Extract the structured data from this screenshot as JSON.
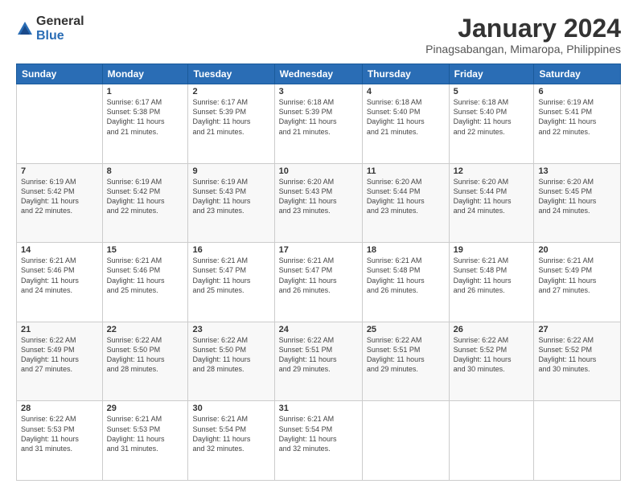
{
  "logo": {
    "general": "General",
    "blue": "Blue"
  },
  "title": "January 2024",
  "location": "Pinagsabangan, Mimaropa, Philippines",
  "days_header": [
    "Sunday",
    "Monday",
    "Tuesday",
    "Wednesday",
    "Thursday",
    "Friday",
    "Saturday"
  ],
  "weeks": [
    [
      {
        "day": "",
        "info": ""
      },
      {
        "day": "1",
        "info": "Sunrise: 6:17 AM\nSunset: 5:38 PM\nDaylight: 11 hours\nand 21 minutes."
      },
      {
        "day": "2",
        "info": "Sunrise: 6:17 AM\nSunset: 5:39 PM\nDaylight: 11 hours\nand 21 minutes."
      },
      {
        "day": "3",
        "info": "Sunrise: 6:18 AM\nSunset: 5:39 PM\nDaylight: 11 hours\nand 21 minutes."
      },
      {
        "day": "4",
        "info": "Sunrise: 6:18 AM\nSunset: 5:40 PM\nDaylight: 11 hours\nand 21 minutes."
      },
      {
        "day": "5",
        "info": "Sunrise: 6:18 AM\nSunset: 5:40 PM\nDaylight: 11 hours\nand 22 minutes."
      },
      {
        "day": "6",
        "info": "Sunrise: 6:19 AM\nSunset: 5:41 PM\nDaylight: 11 hours\nand 22 minutes."
      }
    ],
    [
      {
        "day": "7",
        "info": "Sunrise: 6:19 AM\nSunset: 5:42 PM\nDaylight: 11 hours\nand 22 minutes."
      },
      {
        "day": "8",
        "info": "Sunrise: 6:19 AM\nSunset: 5:42 PM\nDaylight: 11 hours\nand 22 minutes."
      },
      {
        "day": "9",
        "info": "Sunrise: 6:19 AM\nSunset: 5:43 PM\nDaylight: 11 hours\nand 23 minutes."
      },
      {
        "day": "10",
        "info": "Sunrise: 6:20 AM\nSunset: 5:43 PM\nDaylight: 11 hours\nand 23 minutes."
      },
      {
        "day": "11",
        "info": "Sunrise: 6:20 AM\nSunset: 5:44 PM\nDaylight: 11 hours\nand 23 minutes."
      },
      {
        "day": "12",
        "info": "Sunrise: 6:20 AM\nSunset: 5:44 PM\nDaylight: 11 hours\nand 24 minutes."
      },
      {
        "day": "13",
        "info": "Sunrise: 6:20 AM\nSunset: 5:45 PM\nDaylight: 11 hours\nand 24 minutes."
      }
    ],
    [
      {
        "day": "14",
        "info": "Sunrise: 6:21 AM\nSunset: 5:46 PM\nDaylight: 11 hours\nand 24 minutes."
      },
      {
        "day": "15",
        "info": "Sunrise: 6:21 AM\nSunset: 5:46 PM\nDaylight: 11 hours\nand 25 minutes."
      },
      {
        "day": "16",
        "info": "Sunrise: 6:21 AM\nSunset: 5:47 PM\nDaylight: 11 hours\nand 25 minutes."
      },
      {
        "day": "17",
        "info": "Sunrise: 6:21 AM\nSunset: 5:47 PM\nDaylight: 11 hours\nand 26 minutes."
      },
      {
        "day": "18",
        "info": "Sunrise: 6:21 AM\nSunset: 5:48 PM\nDaylight: 11 hours\nand 26 minutes."
      },
      {
        "day": "19",
        "info": "Sunrise: 6:21 AM\nSunset: 5:48 PM\nDaylight: 11 hours\nand 26 minutes."
      },
      {
        "day": "20",
        "info": "Sunrise: 6:21 AM\nSunset: 5:49 PM\nDaylight: 11 hours\nand 27 minutes."
      }
    ],
    [
      {
        "day": "21",
        "info": "Sunrise: 6:22 AM\nSunset: 5:49 PM\nDaylight: 11 hours\nand 27 minutes."
      },
      {
        "day": "22",
        "info": "Sunrise: 6:22 AM\nSunset: 5:50 PM\nDaylight: 11 hours\nand 28 minutes."
      },
      {
        "day": "23",
        "info": "Sunrise: 6:22 AM\nSunset: 5:50 PM\nDaylight: 11 hours\nand 28 minutes."
      },
      {
        "day": "24",
        "info": "Sunrise: 6:22 AM\nSunset: 5:51 PM\nDaylight: 11 hours\nand 29 minutes."
      },
      {
        "day": "25",
        "info": "Sunrise: 6:22 AM\nSunset: 5:51 PM\nDaylight: 11 hours\nand 29 minutes."
      },
      {
        "day": "26",
        "info": "Sunrise: 6:22 AM\nSunset: 5:52 PM\nDaylight: 11 hours\nand 30 minutes."
      },
      {
        "day": "27",
        "info": "Sunrise: 6:22 AM\nSunset: 5:52 PM\nDaylight: 11 hours\nand 30 minutes."
      }
    ],
    [
      {
        "day": "28",
        "info": "Sunrise: 6:22 AM\nSunset: 5:53 PM\nDaylight: 11 hours\nand 31 minutes."
      },
      {
        "day": "29",
        "info": "Sunrise: 6:21 AM\nSunset: 5:53 PM\nDaylight: 11 hours\nand 31 minutes."
      },
      {
        "day": "30",
        "info": "Sunrise: 6:21 AM\nSunset: 5:54 PM\nDaylight: 11 hours\nand 32 minutes."
      },
      {
        "day": "31",
        "info": "Sunrise: 6:21 AM\nSunset: 5:54 PM\nDaylight: 11 hours\nand 32 minutes."
      },
      {
        "day": "",
        "info": ""
      },
      {
        "day": "",
        "info": ""
      },
      {
        "day": "",
        "info": ""
      }
    ]
  ]
}
